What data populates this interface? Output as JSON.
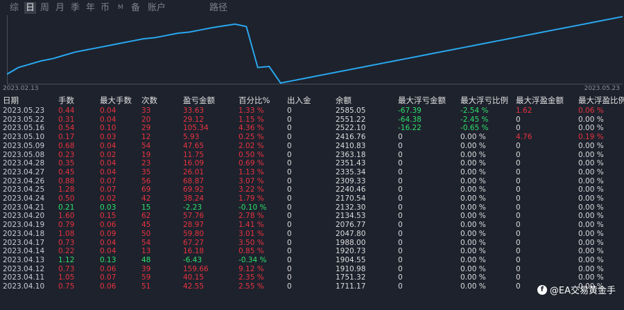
{
  "tabs": [
    {
      "label": "综",
      "active": false
    },
    {
      "label": "日",
      "active": true
    },
    {
      "label": "周",
      "active": false
    },
    {
      "label": "月",
      "active": false
    },
    {
      "label": "季",
      "active": false
    },
    {
      "label": "年",
      "active": false
    },
    {
      "label": "币",
      "active": false
    },
    {
      "label": "M",
      "active": false
    },
    {
      "label": "备",
      "active": false
    },
    {
      "label": "账户",
      "active": false
    },
    {
      "label": "路径",
      "active": false
    }
  ],
  "chart": {
    "start_label": "2023.02.13",
    "end_label": "2023.05.23",
    "line_color": "#29a8ef",
    "balance_series": [
      1040,
      1070,
      1085,
      1100,
      1110,
      1125,
      1140,
      1150,
      1160,
      1170,
      1180,
      1190,
      1200,
      1205,
      1215,
      1225,
      1230,
      1240,
      1250,
      1258,
      1266,
      1255,
      1070,
      1075,
      1000,
      1010,
      1020,
      1030,
      1040,
      1050,
      1060,
      1070,
      1080,
      1090,
      1100,
      1110,
      1120,
      1130,
      1140,
      1150,
      1160,
      1170,
      1180,
      1190,
      1200,
      1210,
      1220,
      1230,
      1240,
      1250,
      1260,
      1270,
      1280,
      1290,
      1300
    ]
  },
  "table": {
    "headers": [
      "日期",
      "手数",
      "最大手数",
      "次数",
      "盈亏金额",
      "百分比%",
      "出入金",
      "余额",
      "最大浮亏金额",
      "最大浮亏比例",
      "最大浮盈金额",
      "最大浮盈比例"
    ],
    "rows": [
      {
        "date": "2023.05.23",
        "lots": "0.44",
        "max_lots": "0.04",
        "count": "33",
        "pnl": "33.63",
        "pct": "1.33 %",
        "io": "0",
        "balance": "2585.05",
        "mfl": "-67.39",
        "mflp": "-2.54 %",
        "mfp": "1.62",
        "mfpp": "0.06 %",
        "dir": "up",
        "mfl_c": "green",
        "mflp_c": "green",
        "mfp_c": "red",
        "mfpp_c": "red"
      },
      {
        "date": "2023.05.22",
        "lots": "0.31",
        "max_lots": "0.04",
        "count": "20",
        "pnl": "29.12",
        "pct": "1.15 %",
        "io": "0",
        "balance": "2551.22",
        "mfl": "-64.38",
        "mflp": "-2.45 %",
        "mfp": "0",
        "mfpp": "0.00 %",
        "dir": "up",
        "mfl_c": "green",
        "mflp_c": "green",
        "mfp_c": "white",
        "mfpp_c": "white"
      },
      {
        "date": "2023.05.16",
        "lots": "0.54",
        "max_lots": "0.10",
        "count": "29",
        "pnl": "105.34",
        "pct": "4.36 %",
        "io": "0",
        "balance": "2522.10",
        "mfl": "-16.22",
        "mflp": "-0.65 %",
        "mfp": "0",
        "mfpp": "0.00 %",
        "dir": "up",
        "mfl_c": "green",
        "mflp_c": "green",
        "mfp_c": "white",
        "mfpp_c": "white"
      },
      {
        "date": "2023.05.10",
        "lots": "0.17",
        "max_lots": "0.03",
        "count": "12",
        "pnl": "5.93",
        "pct": "0.25 %",
        "io": "0",
        "balance": "2416.76",
        "mfl": "0",
        "mflp": "0.00 %",
        "mfp": "4.76",
        "mfpp": "0.19 %",
        "dir": "up",
        "mfl_c": "white",
        "mflp_c": "white",
        "mfp_c": "red",
        "mfpp_c": "red"
      },
      {
        "date": "2023.05.09",
        "lots": "0.68",
        "max_lots": "0.04",
        "count": "54",
        "pnl": "47.65",
        "pct": "2.02 %",
        "io": "0",
        "balance": "2410.83",
        "mfl": "0",
        "mflp": "0.00 %",
        "mfp": "0",
        "mfpp": "0.00 %",
        "dir": "up",
        "mfl_c": "white",
        "mflp_c": "white",
        "mfp_c": "white",
        "mfpp_c": "white"
      },
      {
        "date": "2023.05.08",
        "lots": "0.23",
        "max_lots": "0.02",
        "count": "19",
        "pnl": "11.75",
        "pct": "0.50 %",
        "io": "0",
        "balance": "2363.18",
        "mfl": "0",
        "mflp": "0.00 %",
        "mfp": "0",
        "mfpp": "0.00 %",
        "dir": "up",
        "mfl_c": "white",
        "mflp_c": "white",
        "mfp_c": "white",
        "mfpp_c": "white"
      },
      {
        "date": "2023.04.28",
        "lots": "0.35",
        "max_lots": "0.04",
        "count": "23",
        "pnl": "16.09",
        "pct": "0.69 %",
        "io": "0",
        "balance": "2351.43",
        "mfl": "0",
        "mflp": "0.00 %",
        "mfp": "0",
        "mfpp": "0.00 %",
        "dir": "up",
        "mfl_c": "white",
        "mflp_c": "white",
        "mfp_c": "white",
        "mfpp_c": "white"
      },
      {
        "date": "2023.04.27",
        "lots": "0.45",
        "max_lots": "0.04",
        "count": "35",
        "pnl": "26.01",
        "pct": "1.13 %",
        "io": "0",
        "balance": "2335.34",
        "mfl": "0",
        "mflp": "0.00 %",
        "mfp": "0",
        "mfpp": "0.00 %",
        "dir": "up",
        "mfl_c": "white",
        "mflp_c": "white",
        "mfp_c": "white",
        "mfpp_c": "white"
      },
      {
        "date": "2023.04.26",
        "lots": "0.88",
        "max_lots": "0.07",
        "count": "56",
        "pnl": "68.87",
        "pct": "3.07 %",
        "io": "0",
        "balance": "2309.33",
        "mfl": "0",
        "mflp": "0.00 %",
        "mfp": "0",
        "mfpp": "0.00 %",
        "dir": "up",
        "mfl_c": "white",
        "mflp_c": "white",
        "mfp_c": "white",
        "mfpp_c": "white"
      },
      {
        "date": "2023.04.25",
        "lots": "1.28",
        "max_lots": "0.07",
        "count": "69",
        "pnl": "69.92",
        "pct": "3.22 %",
        "io": "0",
        "balance": "2240.46",
        "mfl": "0",
        "mflp": "0.00 %",
        "mfp": "0",
        "mfpp": "0.00 %",
        "dir": "up",
        "mfl_c": "white",
        "mflp_c": "white",
        "mfp_c": "white",
        "mfpp_c": "white"
      },
      {
        "date": "2023.04.24",
        "lots": "0.50",
        "max_lots": "0.02",
        "count": "42",
        "pnl": "38.24",
        "pct": "1.79 %",
        "io": "0",
        "balance": "2170.54",
        "mfl": "0",
        "mflp": "0.00 %",
        "mfp": "0",
        "mfpp": "0.00 %",
        "dir": "up",
        "mfl_c": "white",
        "mflp_c": "white",
        "mfp_c": "white",
        "mfpp_c": "white"
      },
      {
        "date": "2023.04.21",
        "lots": "0.21",
        "max_lots": "0.03",
        "count": "15",
        "pnl": "-2.23",
        "pct": "-0.10 %",
        "io": "0",
        "balance": "2132.30",
        "mfl": "0",
        "mflp": "0.00 %",
        "mfp": "0",
        "mfpp": "0.00 %",
        "dir": "down",
        "mfl_c": "white",
        "mflp_c": "white",
        "mfp_c": "white",
        "mfpp_c": "white"
      },
      {
        "date": "2023.04.20",
        "lots": "1.60",
        "max_lots": "0.15",
        "count": "62",
        "pnl": "57.76",
        "pct": "2.78 %",
        "io": "0",
        "balance": "2134.53",
        "mfl": "0",
        "mflp": "0.00 %",
        "mfp": "0",
        "mfpp": "0.00 %",
        "dir": "up",
        "mfl_c": "white",
        "mflp_c": "white",
        "mfp_c": "white",
        "mfpp_c": "white"
      },
      {
        "date": "2023.04.19",
        "lots": "0.79",
        "max_lots": "0.06",
        "count": "45",
        "pnl": "28.97",
        "pct": "1.41 %",
        "io": "0",
        "balance": "2076.77",
        "mfl": "0",
        "mflp": "0.00 %",
        "mfp": "0",
        "mfpp": "0.00 %",
        "dir": "up",
        "mfl_c": "white",
        "mflp_c": "white",
        "mfp_c": "white",
        "mfpp_c": "white"
      },
      {
        "date": "2023.04.18",
        "lots": "1.08",
        "max_lots": "0.09",
        "count": "50",
        "pnl": "59.80",
        "pct": "3.01 %",
        "io": "0",
        "balance": "2047.80",
        "mfl": "0",
        "mflp": "0.00 %",
        "mfp": "0",
        "mfpp": "0.00 %",
        "dir": "up",
        "mfl_c": "white",
        "mflp_c": "white",
        "mfp_c": "white",
        "mfpp_c": "white"
      },
      {
        "date": "2023.04.17",
        "lots": "0.73",
        "max_lots": "0.04",
        "count": "54",
        "pnl": "67.27",
        "pct": "3.50 %",
        "io": "0",
        "balance": "1988.00",
        "mfl": "0",
        "mflp": "0.00 %",
        "mfp": "0",
        "mfpp": "0.00 %",
        "dir": "up",
        "mfl_c": "white",
        "mflp_c": "white",
        "mfp_c": "white",
        "mfpp_c": "white"
      },
      {
        "date": "2023.04.14",
        "lots": "0.22",
        "max_lots": "0.04",
        "count": "13",
        "pnl": "16.18",
        "pct": "0.85 %",
        "io": "0",
        "balance": "1920.73",
        "mfl": "0",
        "mflp": "0.00 %",
        "mfp": "0",
        "mfpp": "0.00 %",
        "dir": "up",
        "mfl_c": "white",
        "mflp_c": "white",
        "mfp_c": "white",
        "mfpp_c": "white"
      },
      {
        "date": "2023.04.13",
        "lots": "1.12",
        "max_lots": "0.13",
        "count": "48",
        "pnl": "-6.43",
        "pct": "-0.34 %",
        "io": "0",
        "balance": "1904.55",
        "mfl": "0",
        "mflp": "0.00 %",
        "mfp": "0",
        "mfpp": "0.00 %",
        "dir": "down",
        "mfl_c": "white",
        "mflp_c": "white",
        "mfp_c": "white",
        "mfpp_c": "white"
      },
      {
        "date": "2023.04.12",
        "lots": "0.73",
        "max_lots": "0.06",
        "count": "39",
        "pnl": "159.66",
        "pct": "9.12 %",
        "io": "0",
        "balance": "1910.98",
        "mfl": "0",
        "mflp": "0.00 %",
        "mfp": "0",
        "mfpp": "0.00 %",
        "dir": "up",
        "mfl_c": "white",
        "mflp_c": "white",
        "mfp_c": "white",
        "mfpp_c": "white"
      },
      {
        "date": "2023.04.11",
        "lots": "1.05",
        "max_lots": "0.07",
        "count": "59",
        "pnl": "40.15",
        "pct": "2.35 %",
        "io": "0",
        "balance": "1751.32",
        "mfl": "0",
        "mflp": "0.00 %",
        "mfp": "0",
        "mfpp": "0.00 %",
        "dir": "up",
        "mfl_c": "white",
        "mflp_c": "white",
        "mfp_c": "white",
        "mfpp_c": "white"
      },
      {
        "date": "2023.04.10",
        "lots": "0.75",
        "max_lots": "0.06",
        "count": "51",
        "pnl": "42.55",
        "pct": "2.55 %",
        "io": "0",
        "balance": "1711.17",
        "mfl": "0",
        "mflp": "0.00 %",
        "mfp": "0",
        "mfpp": "0.00 %",
        "dir": "up",
        "mfl_c": "white",
        "mflp_c": "white",
        "mfp_c": "white",
        "mfpp_c": "white"
      }
    ]
  },
  "watermark": {
    "text": "@EA交易黄金手",
    "logo": "f"
  }
}
